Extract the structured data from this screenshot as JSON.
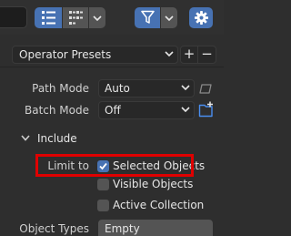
{
  "toolbar": {
    "view_mode_icons": [
      "list-view-icon",
      "columns-view-icon"
    ],
    "filter_icon": "funnel-icon",
    "settings_icon": "gear-icon",
    "accent_color": "#4772b3"
  },
  "presets": {
    "label": "Operator Presets",
    "add_label": "+",
    "remove_label": "−"
  },
  "path_mode": {
    "label": "Path Mode",
    "value": "Auto"
  },
  "batch_mode": {
    "label": "Batch Mode",
    "value": "Off"
  },
  "include": {
    "header": "Include",
    "limit_to_label": "Limit to",
    "options": [
      {
        "label": "Selected Objects",
        "checked": true
      },
      {
        "label": "Visible Objects",
        "checked": false
      },
      {
        "label": "Active Collection",
        "checked": false
      }
    ]
  },
  "object_types": {
    "label": "Object Types",
    "value": "Empty"
  }
}
